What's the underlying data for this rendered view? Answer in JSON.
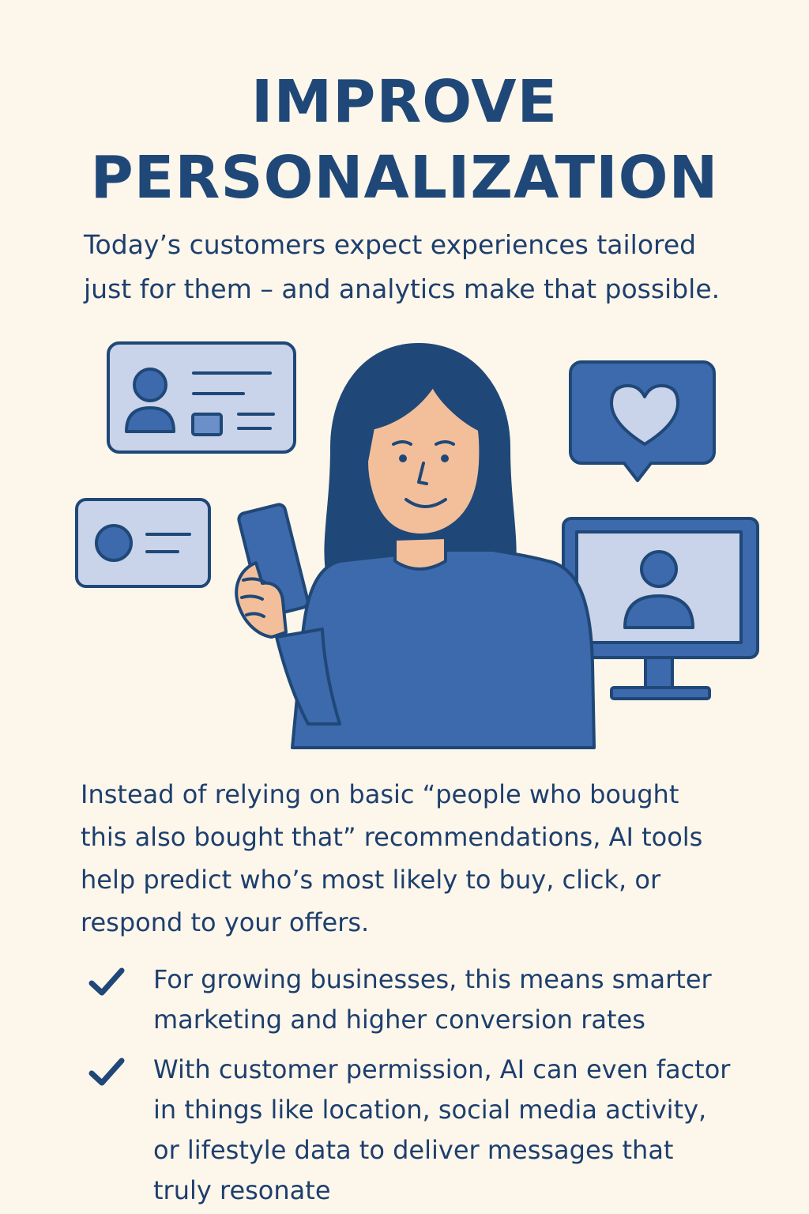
{
  "title": {
    "line1": "IMPROVE",
    "line2": "PERSONALIZATION"
  },
  "intro": {
    "line1": "Today’s customers expect experiences tailored",
    "line2": "just for them – and analytics make that possible."
  },
  "body": {
    "line1": "Instead of relying on basic “people who bought",
    "line2": "this also bought that” recommendations, AI tools",
    "line3": "help predict who’s most likely to buy, click, or",
    "line4": "respond to your offers."
  },
  "bullets": [
    {
      "icon": "check-icon",
      "line1": "For growing businesses, this means smarter",
      "line2": "marketing and higher conversion rates"
    },
    {
      "icon": "check-icon",
      "line1": "With customer permission, AI can even factor",
      "line2": "in things like location, social media activity,",
      "line3": "or lifestyle data to deliver messages that",
      "line4": "truly resonate"
    }
  ],
  "colors": {
    "background": "#fdf6ea",
    "navy": "#1f4878",
    "blue": "#3d6aac",
    "light_blue": "#c9d3e9",
    "skin": "#f2bf9a"
  }
}
